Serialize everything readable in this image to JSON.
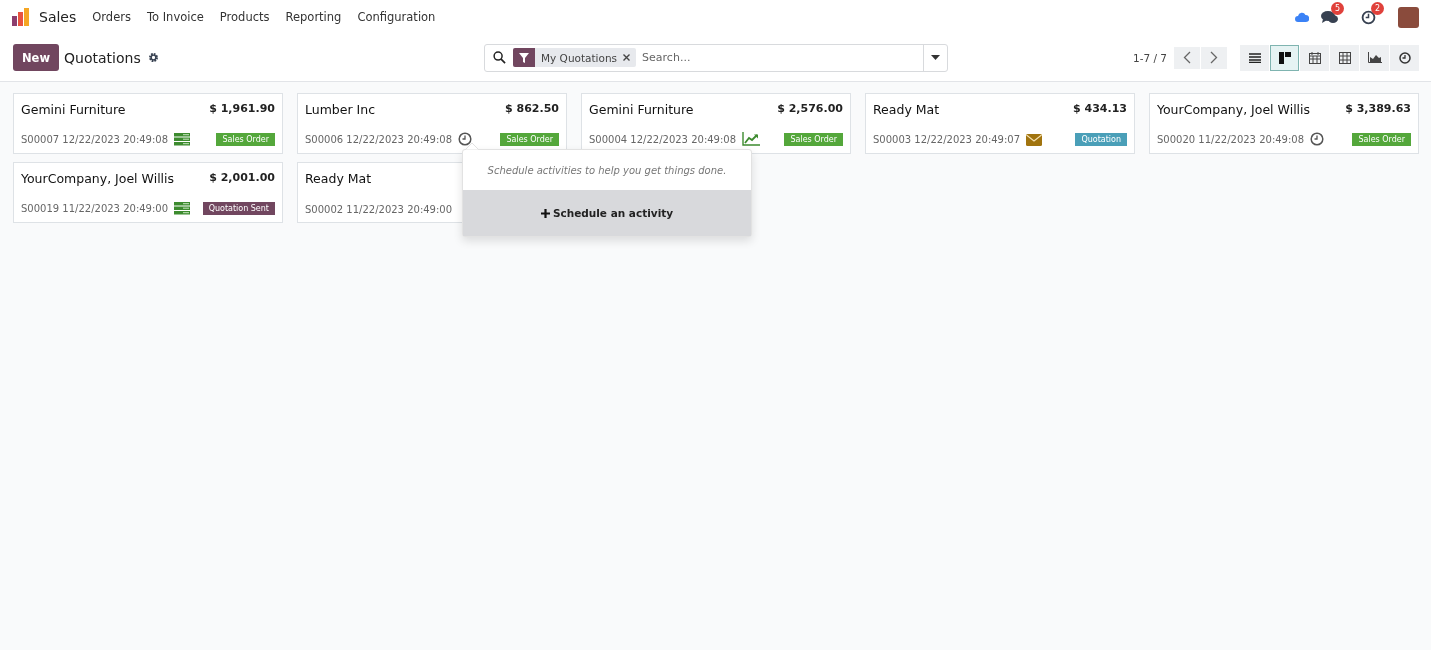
{
  "navbar": {
    "app_name": "Sales",
    "menu": [
      "Orders",
      "To Invoice",
      "Products",
      "Reporting",
      "Configuration"
    ],
    "messages_count": "5",
    "activities_count": "2"
  },
  "control_panel": {
    "new_button": "New",
    "title": "Quotations",
    "search": {
      "facet": "My Quotations",
      "placeholder": "Search..."
    },
    "pager": "1-7 / 7",
    "views": [
      {
        "kind": "list",
        "selected": false
      },
      {
        "kind": "kanban",
        "selected": true
      },
      {
        "kind": "calendar",
        "selected": false
      },
      {
        "kind": "pivot",
        "selected": false
      },
      {
        "kind": "graph",
        "selected": false
      },
      {
        "kind": "activity",
        "selected": false
      }
    ]
  },
  "cards": [
    {
      "customer": "Gemini Furniture",
      "amount": "$ 1,961.90",
      "reference": "S00007 12/22/2023 20:49:08",
      "activity": {
        "kind": "todo"
      },
      "status": {
        "label": "Sales Order",
        "color": "#54a73b"
      }
    },
    {
      "customer": "Lumber Inc",
      "amount": "$ 862.50",
      "reference": "S00006 12/22/2023 20:49:08",
      "activity": {
        "kind": "clock"
      },
      "status": {
        "label": "Sales Order",
        "color": "#54a73b"
      }
    },
    {
      "customer": "Gemini Furniture",
      "amount": "$ 2,576.00",
      "reference": "S00004 12/22/2023 20:49:08",
      "activity": {
        "kind": "chart"
      },
      "status": {
        "label": "Sales Order",
        "color": "#54a73b"
      }
    },
    {
      "customer": "Ready Mat",
      "amount": "$ 434.13",
      "reference": "S00003 12/22/2023 20:49:07",
      "activity": {
        "kind": "email"
      },
      "status": {
        "label": "Quotation",
        "color": "#4a9fb8"
      }
    },
    {
      "customer": "YourCompany, Joel Willis",
      "amount": "$ 3,389.63",
      "reference": "S00020 11/22/2023 20:49:08",
      "activity": {
        "kind": "clock"
      },
      "status": {
        "label": "Sales Order",
        "color": "#54a73b"
      }
    },
    {
      "customer": "YourCompany, Joel Willis",
      "amount": "$ 2,001.00",
      "reference": "S00019 11/22/2023 20:49:00",
      "activity": {
        "kind": "todo"
      },
      "status": {
        "label": "Quotation Sent",
        "color": "#71465f"
      }
    },
    {
      "customer": "Ready Mat",
      "reference": "S00002 11/22/2023 20:49:00"
    }
  ],
  "activity_popover": {
    "hint": "Schedule activities to help you get things done.",
    "button": "Schedule an activity"
  }
}
